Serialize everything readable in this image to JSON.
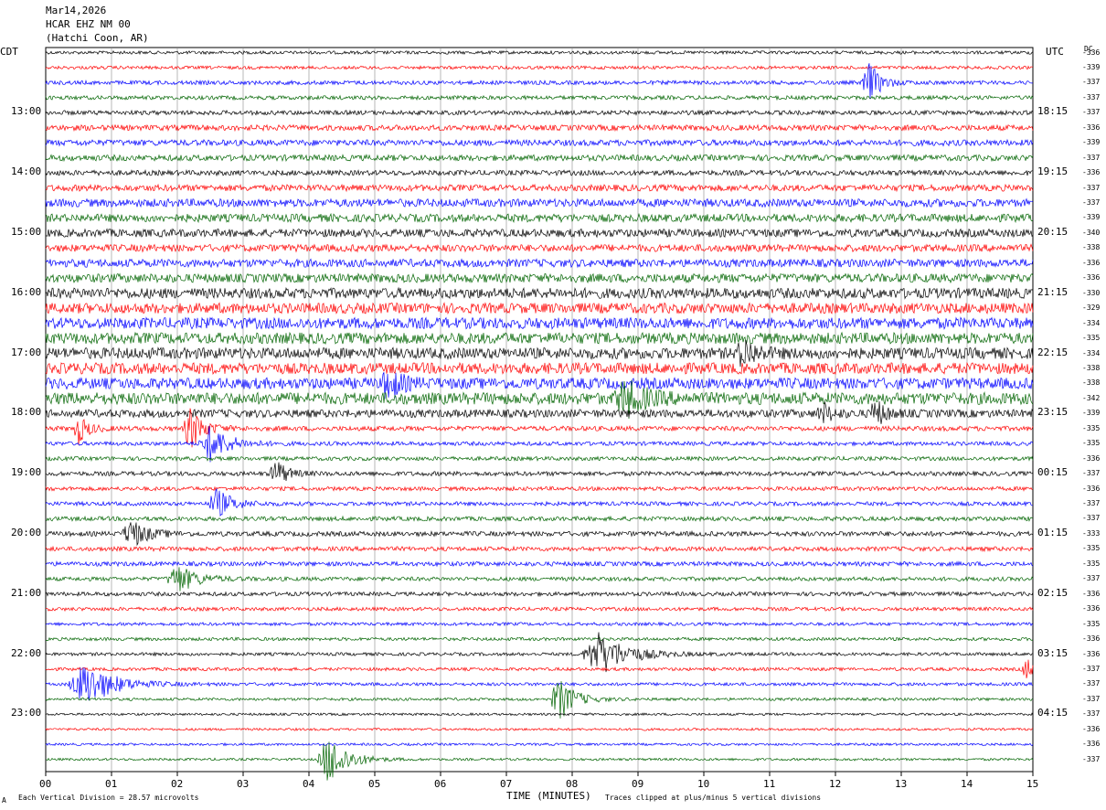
{
  "header": {
    "date": "Mar14,2026",
    "station": "HCAR EHZ NM 00",
    "location": "(Hatchi Coon, AR)"
  },
  "corner": {
    "left_tz": "CDT",
    "right_tz": "UTC",
    "dc_label": "DC"
  },
  "footer": {
    "scale_note": "Each Vertical Division =   28.57 microvolts",
    "clip_note": "Traces clipped at plus/minus 5 vertical divisions",
    "corner_mark": "A"
  },
  "chart_data": {
    "type": "line",
    "title": "",
    "xlabel": "TIME (MINUTES)",
    "ylabel": "",
    "xlim": [
      0,
      15
    ],
    "x_ticks": [
      "00",
      "01",
      "02",
      "03",
      "04",
      "05",
      "06",
      "07",
      "08",
      "09",
      "10",
      "11",
      "12",
      "13",
      "14",
      "15"
    ],
    "left_hour_labels": [
      "13:00",
      "14:00",
      "15:00",
      "16:00",
      "17:00",
      "18:00",
      "19:00",
      "20:00",
      "21:00",
      "22:00",
      "23:00"
    ],
    "right_hour_labels": [
      "18:15",
      "19:15",
      "20:15",
      "21:15",
      "22:15",
      "23:15",
      "00:15",
      "01:15",
      "02:15",
      "03:15",
      "04:15"
    ],
    "trace_count": 48,
    "trace_colors": [
      "#000000",
      "#ff0000",
      "#0000ff",
      "#006400"
    ],
    "dc_offsets": [
      336,
      339,
      337,
      337,
      337,
      336,
      339,
      337,
      336,
      337,
      337,
      339,
      340,
      338,
      336,
      336,
      330,
      329,
      334,
      335,
      334,
      338,
      338,
      342,
      339,
      335,
      335,
      336,
      337,
      336,
      337,
      337,
      333,
      335,
      335,
      337,
      336,
      336,
      335,
      336,
      336,
      337,
      337,
      337,
      337,
      336,
      336,
      337
    ],
    "noise_levels": [
      0.8,
      0.8,
      1.0,
      1.0,
      1.1,
      1.4,
      1.5,
      1.5,
      1.3,
      1.6,
      2.0,
      2.0,
      2.0,
      1.8,
      2.0,
      2.2,
      2.6,
      2.6,
      2.8,
      2.8,
      2.8,
      2.8,
      2.8,
      3.0,
      2.0,
      1.2,
      1.0,
      1.0,
      1.1,
      1.0,
      1.0,
      1.1,
      1.2,
      1.1,
      1.1,
      1.0,
      1.0,
      0.9,
      0.8,
      0.8,
      0.8,
      0.8,
      0.8,
      0.7,
      0.6,
      0.6,
      0.6,
      0.6
    ],
    "events": [
      {
        "trace": 2,
        "minute": 12.5,
        "amplitude": 6,
        "width": 0.35
      },
      {
        "trace": 20,
        "minute": 10.6,
        "amplitude": 4,
        "width": 0.4
      },
      {
        "trace": 22,
        "minute": 5.2,
        "amplitude": 5,
        "width": 0.35
      },
      {
        "trace": 23,
        "minute": 8.8,
        "amplitude": 5,
        "width": 0.6
      },
      {
        "trace": 24,
        "minute": 12.6,
        "amplitude": 4,
        "width": 0.3
      },
      {
        "trace": 24,
        "minute": 11.8,
        "amplitude": 3,
        "width": 0.3
      },
      {
        "trace": 25,
        "minute": 2.2,
        "amplitude": 6,
        "width": 0.4
      },
      {
        "trace": 25,
        "minute": 0.5,
        "amplitude": 4,
        "width": 0.3
      },
      {
        "trace": 26,
        "minute": 2.5,
        "amplitude": 5,
        "width": 0.6
      },
      {
        "trace": 28,
        "minute": 3.5,
        "amplitude": 4,
        "width": 0.35
      },
      {
        "trace": 30,
        "minute": 2.6,
        "amplitude": 4,
        "width": 0.5
      },
      {
        "trace": 32,
        "minute": 1.3,
        "amplitude": 4,
        "width": 0.5
      },
      {
        "trace": 35,
        "minute": 2.0,
        "amplitude": 4,
        "width": 0.6
      },
      {
        "trace": 40,
        "minute": 8.4,
        "amplitude": 6,
        "width": 0.9
      },
      {
        "trace": 41,
        "minute": 14.9,
        "amplitude": 3,
        "width": 0.3
      },
      {
        "trace": 42,
        "minute": 0.6,
        "amplitude": 6,
        "width": 0.9
      },
      {
        "trace": 43,
        "minute": 7.8,
        "amplitude": 6,
        "width": 0.5
      },
      {
        "trace": 47,
        "minute": 4.3,
        "amplitude": 7,
        "width": 0.6
      }
    ]
  }
}
